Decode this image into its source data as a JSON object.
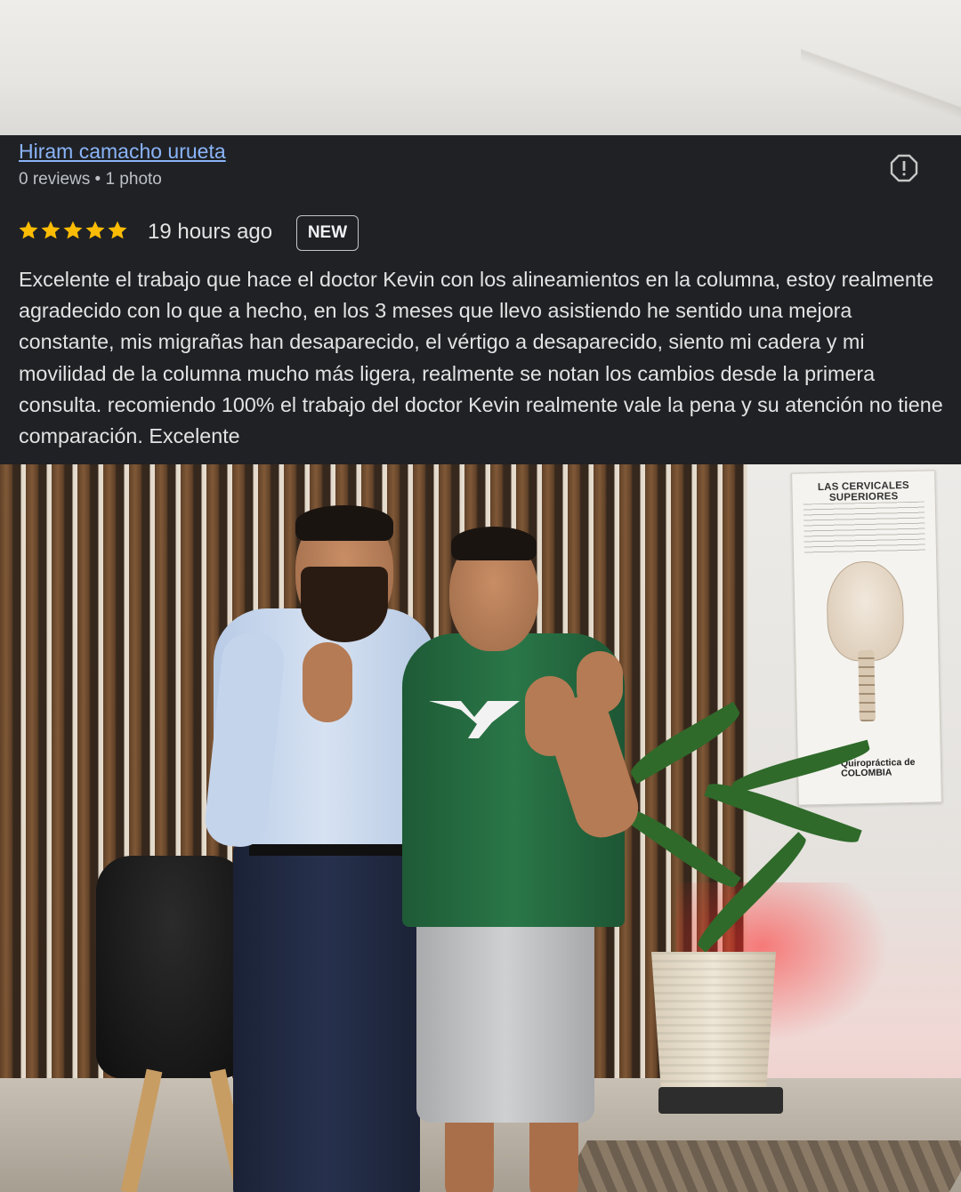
{
  "review": {
    "reviewer_name": "Hiram camacho urueta",
    "reviewer_meta": "0 reviews • 1 photo",
    "rating": 5,
    "time_ago": "19 hours ago",
    "badge": "NEW",
    "text": "Excelente el trabajo que hace el doctor Kevin con los alineamientos en la columna, estoy realmente agradecido con lo que a hecho, en los 3 meses que llevo asistiendo he sentido una mejora constante, mis migrañas han desaparecido, el vértigo a desaparecido, siento mi cadera y mi movilidad de la columna mucho más ligera, realmente se notan los cambios desde la primera consulta. recomiendo 100% el trabajo del doctor Kevin realmente vale la pena y su atención no tiene comparación. Excelente"
  },
  "icons": {
    "report": "report-flag-icon",
    "star": "star-icon"
  },
  "colors": {
    "card_bg": "#1f2125",
    "link": "#8ab4f8",
    "star": "#fbbc04",
    "text": "#e3e3e3"
  },
  "photo": {
    "poster_title": "LAS CERVICALES SUPERIORES",
    "poster_brand": "Quiropráctica de COLOMBIA"
  }
}
